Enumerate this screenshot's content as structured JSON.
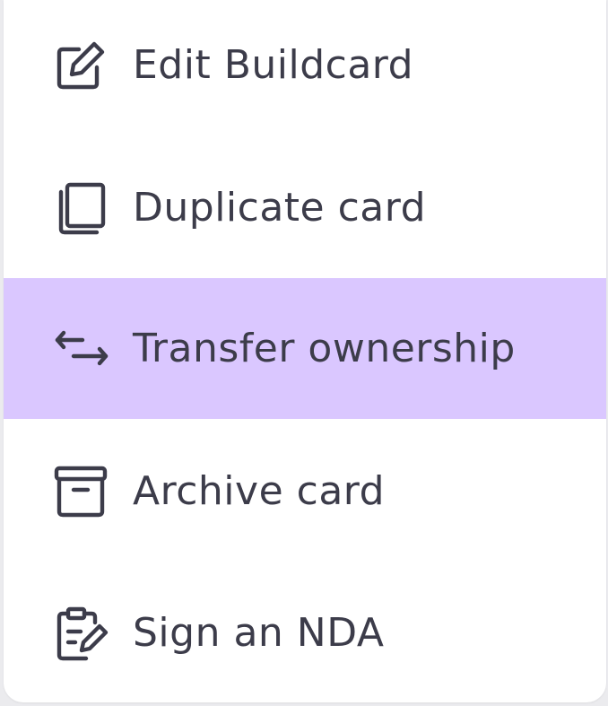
{
  "menu": {
    "items": [
      {
        "label": "Edit Buildcard",
        "icon": "edit-icon",
        "active": false
      },
      {
        "label": "Duplicate card",
        "icon": "duplicate-icon",
        "active": false
      },
      {
        "label": "Transfer ownership",
        "icon": "transfer-icon",
        "active": true
      },
      {
        "label": "Archive card",
        "icon": "archive-icon",
        "active": false
      },
      {
        "label": "Sign an NDA",
        "icon": "sign-document-icon",
        "active": false
      }
    ]
  },
  "colors": {
    "active_background": "#dac7ff",
    "text": "#3c3c4a",
    "menu_background": "#ffffff"
  }
}
